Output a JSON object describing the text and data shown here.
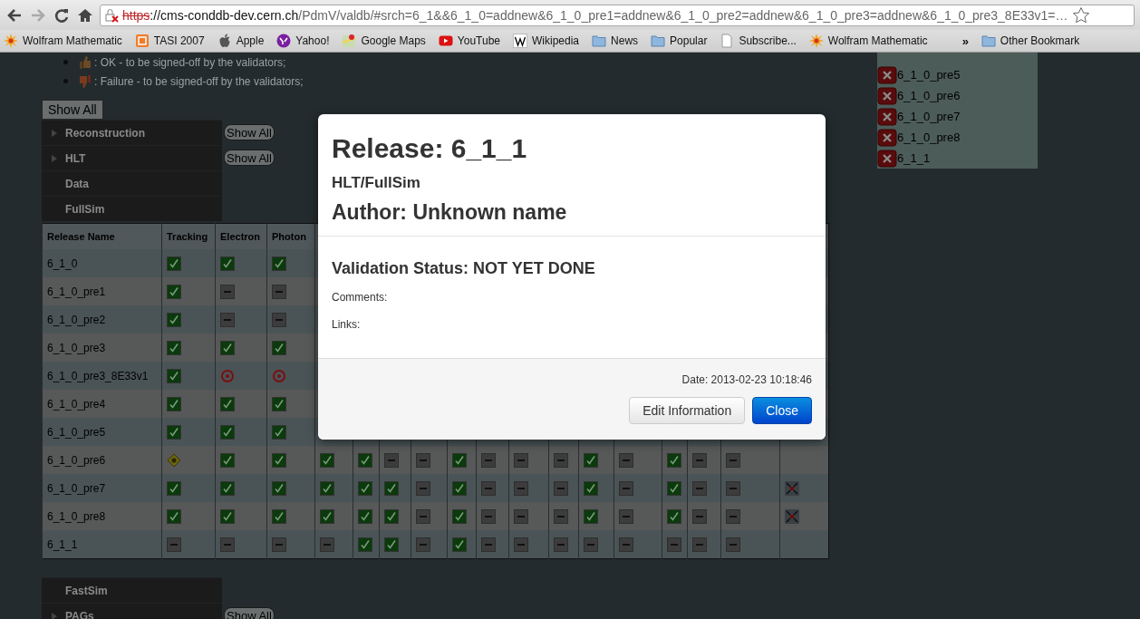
{
  "browser": {
    "url_scheme": "https",
    "url_host": "://cms-conddb-dev.cern.ch",
    "url_path": "/PdmV/valdb/#srch=6_1&&6_1_0=addnew&6_1_0_pre1=addnew&6_1_0_pre2=addnew&6_1_0_pre3=addnew&6_1_0_pre3_8E33v1=…",
    "bookmarks": [
      {
        "kind": "burst",
        "label": "Wolfram Mathematic"
      },
      {
        "kind": "tasi",
        "label": "TASI 2007"
      },
      {
        "kind": "apple",
        "label": "Apple"
      },
      {
        "kind": "yahoo",
        "label": "Yahoo!"
      },
      {
        "kind": "maps",
        "label": "Google Maps"
      },
      {
        "kind": "youtube",
        "label": "YouTube"
      },
      {
        "kind": "wiki",
        "label": "Wikipedia"
      },
      {
        "kind": "folder",
        "label": "News"
      },
      {
        "kind": "folder",
        "label": "Popular"
      },
      {
        "kind": "page",
        "label": "Subscribe..."
      },
      {
        "kind": "burst",
        "label": "Wolfram Mathematic"
      }
    ],
    "overflow": "»",
    "other_bookmarks": "Other Bookmark"
  },
  "legend": [
    {
      "kind": "up",
      "text": ": OK - to be signed-off by the validators;"
    },
    {
      "kind": "down",
      "text": ": Failure - to be signed-off by the validators;"
    }
  ],
  "show_all": "Show All",
  "menu": [
    {
      "label": "Reconstruction",
      "expandable": true,
      "button": "Show All"
    },
    {
      "label": "HLT",
      "expandable": true,
      "button": "Show All"
    },
    {
      "label": "Data",
      "expandable": false
    },
    {
      "label": "FullSim",
      "expandable": false
    }
  ],
  "table": {
    "columns": [
      "Release Name",
      "Tracking",
      "Electron",
      "Photon"
    ],
    "rows": [
      {
        "name": "6_1_0",
        "cells": [
          {
            "kind": "ok"
          },
          {
            "kind": "ok"
          },
          {
            "kind": "ok"
          }
        ]
      },
      {
        "name": "6_1_0_pre1",
        "cells": [
          {
            "kind": "ok"
          },
          {
            "kind": "na"
          },
          {
            "kind": "na"
          }
        ]
      },
      {
        "name": "6_1_0_pre2",
        "cells": [
          {
            "kind": "ok"
          },
          {
            "kind": "na"
          },
          {
            "kind": "na"
          }
        ]
      },
      {
        "name": "6_1_0_pre3",
        "cells": [
          {
            "kind": "ok"
          },
          {
            "kind": "ok"
          },
          {
            "kind": "ok"
          }
        ]
      },
      {
        "name": "6_1_0_pre3_8E33v1",
        "cells": [
          {
            "kind": "ok"
          },
          {
            "kind": "fail"
          },
          {
            "kind": "fail"
          }
        ]
      },
      {
        "name": "6_1_0_pre4",
        "cells": [
          {
            "kind": "ok"
          },
          {
            "kind": "ok"
          },
          {
            "kind": "ok"
          }
        ]
      },
      {
        "name": "6_1_0_pre5",
        "cells": [
          {
            "kind": "ok"
          },
          {
            "kind": "ok"
          },
          {
            "kind": "ok"
          }
        ]
      },
      {
        "name": "6_1_0_pre6",
        "cells": [
          {
            "kind": "warn"
          },
          {
            "kind": "ok"
          },
          {
            "kind": "ok"
          },
          {
            "kind": "ok"
          },
          {
            "kind": "ok"
          },
          {
            "kind": "na"
          },
          {
            "kind": "na"
          },
          {
            "kind": "ok"
          },
          {
            "kind": "na"
          },
          {
            "kind": "na"
          },
          {
            "kind": "na"
          },
          {
            "kind": "ok"
          },
          {
            "kind": "na"
          },
          {
            "kind": "ok"
          },
          {
            "kind": "na"
          },
          {
            "kind": "na"
          },
          {
            "kind": "empty"
          }
        ]
      },
      {
        "name": "6_1_0_pre7",
        "cells": [
          {
            "kind": "ok"
          },
          {
            "kind": "ok"
          },
          {
            "kind": "ok"
          },
          {
            "kind": "ok"
          },
          {
            "kind": "ok"
          },
          {
            "kind": "ok"
          },
          {
            "kind": "na"
          },
          {
            "kind": "ok"
          },
          {
            "kind": "na"
          },
          {
            "kind": "na"
          },
          {
            "kind": "na"
          },
          {
            "kind": "ok"
          },
          {
            "kind": "na"
          },
          {
            "kind": "ok"
          },
          {
            "kind": "na"
          },
          {
            "kind": "na"
          },
          {
            "kind": "merge"
          }
        ]
      },
      {
        "name": "6_1_0_pre8",
        "cells": [
          {
            "kind": "ok"
          },
          {
            "kind": "ok"
          },
          {
            "kind": "ok"
          },
          {
            "kind": "ok"
          },
          {
            "kind": "ok"
          },
          {
            "kind": "ok"
          },
          {
            "kind": "na"
          },
          {
            "kind": "ok"
          },
          {
            "kind": "na"
          },
          {
            "kind": "na"
          },
          {
            "kind": "na"
          },
          {
            "kind": "ok"
          },
          {
            "kind": "na"
          },
          {
            "kind": "ok"
          },
          {
            "kind": "na"
          },
          {
            "kind": "na"
          },
          {
            "kind": "merge"
          }
        ]
      },
      {
        "name": "6_1_1",
        "cells": [
          {
            "kind": "na"
          },
          {
            "kind": "na"
          },
          {
            "kind": "na"
          },
          {
            "kind": "na"
          },
          {
            "kind": "ok"
          },
          {
            "kind": "ok"
          },
          {
            "kind": "na"
          },
          {
            "kind": "ok"
          },
          {
            "kind": "na"
          },
          {
            "kind": "na"
          },
          {
            "kind": "na"
          },
          {
            "kind": "na"
          },
          {
            "kind": "na"
          },
          {
            "kind": "na"
          },
          {
            "kind": "na"
          },
          {
            "kind": "na"
          },
          {
            "kind": "empty"
          }
        ]
      }
    ]
  },
  "lower_menu": [
    {
      "label": "FastSim",
      "expandable": false
    },
    {
      "label": "PAGs",
      "expandable": true,
      "button": "Show All"
    }
  ],
  "removed": [
    "6_1_0_pre5",
    "6_1_0_pre6",
    "6_1_0_pre7",
    "6_1_0_pre8",
    "6_1_1"
  ],
  "modal": {
    "title": "Release: 6_1_1",
    "category": "HLT/FullSim",
    "author": "Author: Unknown name",
    "status": "Validation Status: NOT YET DONE",
    "comments": "Comments:",
    "links": "Links:",
    "date": "Date: 2013-02-23 10:18:46",
    "buttons": [
      {
        "label": "Edit Information",
        "primary": false
      },
      {
        "label": "Close",
        "primary": true
      }
    ]
  }
}
